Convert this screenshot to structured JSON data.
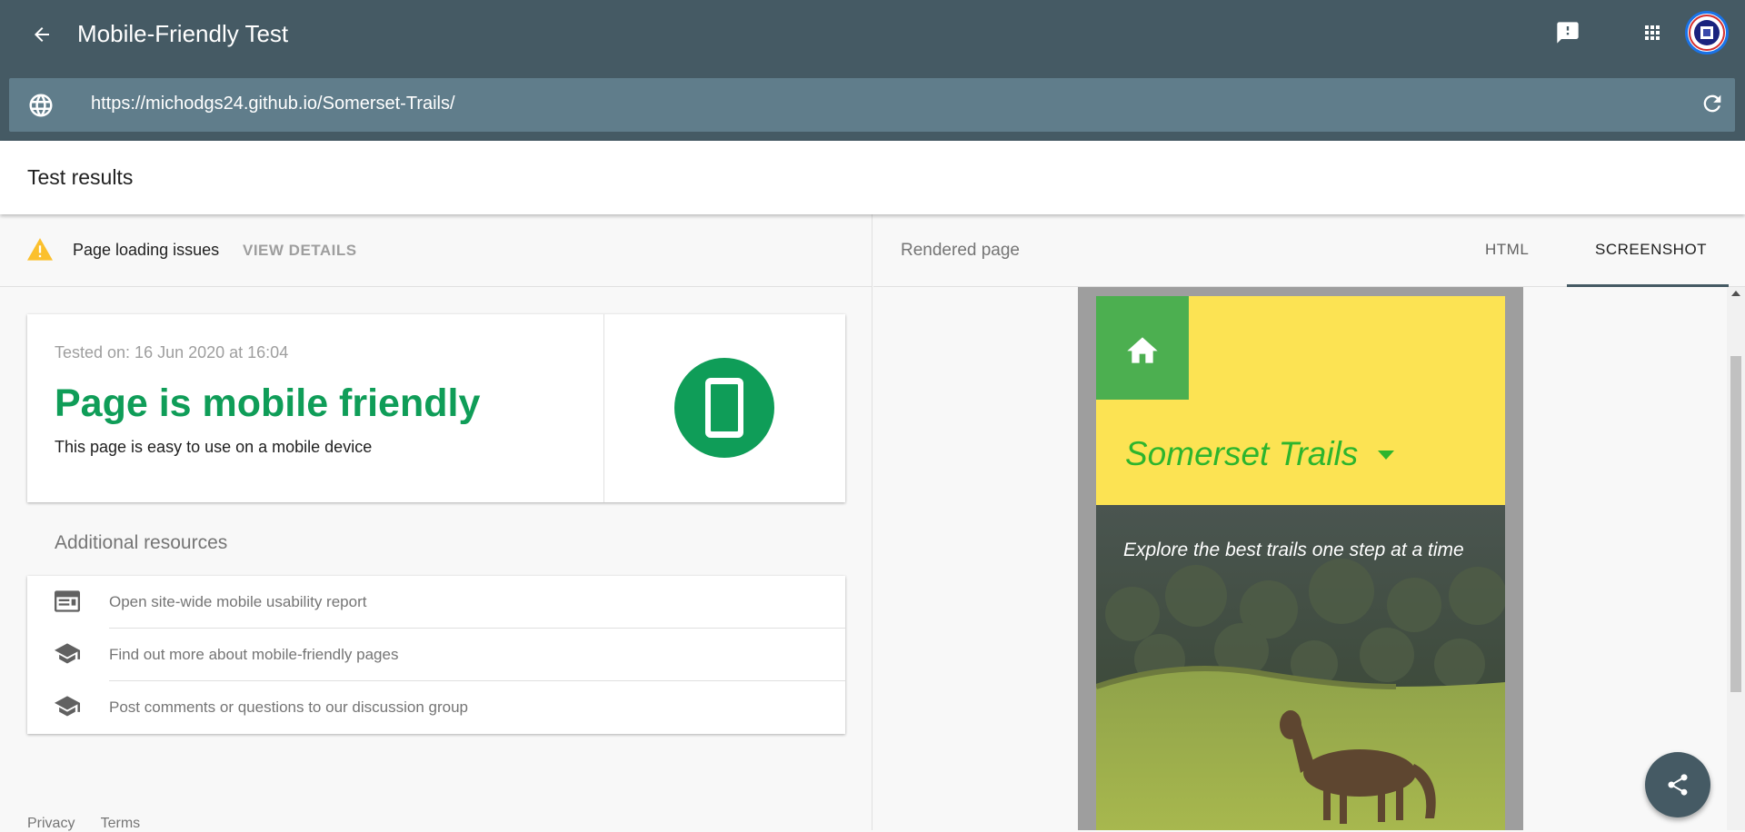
{
  "header": {
    "title": "Mobile-Friendly Test",
    "back_icon": "arrow-back-icon",
    "feedback_icon": "feedback-icon",
    "apps_icon": "apps-grid-icon"
  },
  "urlbar": {
    "url": "https://michodgs24.github.io/Somerset-Trails/",
    "globe_icon": "globe-icon",
    "refresh_icon": "refresh-icon"
  },
  "results": {
    "title": "Test results"
  },
  "issues": {
    "text": "Page loading issues",
    "link": "VIEW DETAILS"
  },
  "summary": {
    "tested_on": "Tested on: 16 Jun 2020 at 16:04",
    "verdict": "Page is mobile friendly",
    "description": "This page is easy to use on a mobile device"
  },
  "resources": {
    "title": "Additional resources",
    "items": [
      {
        "label": "Open site-wide mobile usability report",
        "icon": "web-layout-icon"
      },
      {
        "label": "Find out more about mobile-friendly pages",
        "icon": "school-icon"
      },
      {
        "label": "Post comments or questions to our discussion group",
        "icon": "school-icon"
      }
    ]
  },
  "footer": {
    "privacy": "Privacy",
    "terms": "Terms"
  },
  "rendered": {
    "label": "Rendered page",
    "tabs": [
      "HTML",
      "SCREENSHOT"
    ],
    "active_tab": "SCREENSHOT",
    "site_title": "Somerset Trails",
    "tagline": "Explore the best trails one step at a time"
  },
  "colors": {
    "header": "#455a64",
    "urlbar": "#607d8b",
    "success": "#0f9d58",
    "site_yellow": "#fce353",
    "site_green": "#4caf50"
  }
}
